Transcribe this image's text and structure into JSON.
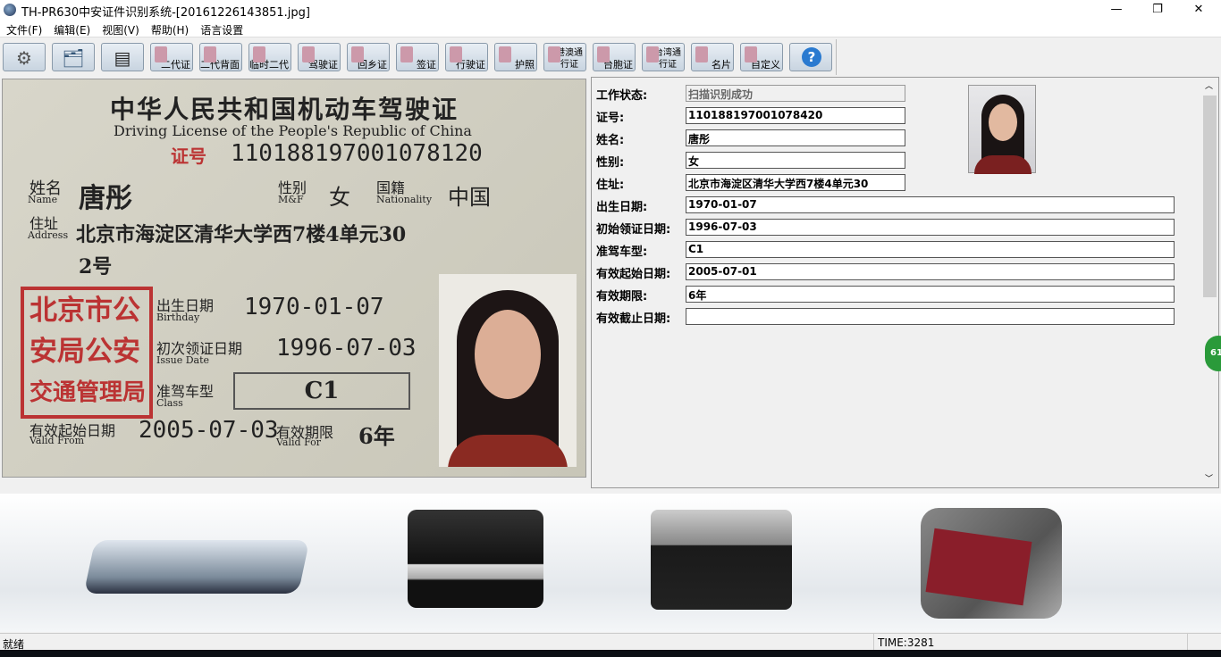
{
  "window": {
    "title": "TH-PR630中安证件识别系统-[20161226143851.jpg]",
    "minimize": "—",
    "restore": "❐",
    "close": "✕"
  },
  "menu": [
    "文件(F)",
    "编辑(E)",
    "视图(V)",
    "帮助(H)",
    "语言设置"
  ],
  "toolbar": [
    {
      "name": "settings",
      "label": "",
      "icon": "gear-icon"
    },
    {
      "name": "batch",
      "label": "",
      "icon": "cards-icon"
    },
    {
      "name": "scan",
      "label": "",
      "icon": "scanner-icon"
    },
    {
      "name": "id-card-2nd",
      "label": "二代证"
    },
    {
      "name": "id-card-back",
      "label": "二代背面"
    },
    {
      "name": "temp-id",
      "label": "临时二代"
    },
    {
      "name": "driving-license",
      "label": "驾驶证"
    },
    {
      "name": "home-return",
      "label": "回乡证"
    },
    {
      "name": "visa",
      "label": "签证"
    },
    {
      "name": "vehicle-license",
      "label": "行驶证"
    },
    {
      "name": "passport",
      "label": "护照"
    },
    {
      "name": "hk-macau-permit",
      "label": "港澳通行证"
    },
    {
      "name": "taiwan-compat",
      "label": "台胞证"
    },
    {
      "name": "taiwan-permit",
      "label": "台湾通行证"
    },
    {
      "name": "business-card",
      "label": "名片"
    },
    {
      "name": "custom",
      "label": "自定义"
    },
    {
      "name": "help",
      "label": "?",
      "icon": "help-icon"
    }
  ],
  "card": {
    "title_cn": "中华人民共和国机动车驾驶证",
    "title_en": "Driving License of the People's Republic of China",
    "no_label": "证号",
    "no": "110188197001078120",
    "name_label": "姓名",
    "name_en": "Name",
    "name": "唐彤",
    "sex_label": "性别",
    "sex_en": "M&F",
    "sex": "女",
    "nat_label": "国籍",
    "nat_en": "Nationality",
    "nat": "中国",
    "addr_label": "住址",
    "addr_en": "Address",
    "addr1": "北京市海淀区清华大学西7楼4单元30",
    "addr2": "2号",
    "seal": [
      "北京市公",
      "安局公安",
      "交通管理局"
    ],
    "birth_label": "出生日期",
    "birth_en": "Birthday",
    "birth": "1970-01-07",
    "issue_label": "初次领证日期",
    "issue_en": "Issue Date",
    "issue": "1996-07-03",
    "class_label": "准驾车型",
    "class_en": "Class",
    "class": "C1",
    "valid_label": "有效起始日期",
    "valid_en": "Valid From",
    "valid": "2005-07-03",
    "period_label": "有效期限",
    "period_en": "Valid For",
    "period": "6年"
  },
  "fields": [
    {
      "label": "工作状态:",
      "value": "扫描识别成功",
      "readonly": true
    },
    {
      "label": "证号:",
      "value": "110188197001078420"
    },
    {
      "label": "姓名:",
      "value": "唐彤"
    },
    {
      "label": "性别:",
      "value": "女"
    },
    {
      "label": "住址:",
      "value": "北京市海淀区清华大学西7楼4单元30"
    },
    {
      "label": "出生日期:",
      "value": "1970-01-07"
    },
    {
      "label": "初始领证日期:",
      "value": "1996-07-03"
    },
    {
      "label": "准驾车型:",
      "value": "C1"
    },
    {
      "label": "有效起始日期:",
      "value": "2005-07-01"
    },
    {
      "label": "有效期限:",
      "value": "6年"
    },
    {
      "label": "有效截止日期:",
      "value": ""
    }
  ],
  "badge": "61",
  "status": {
    "left": "就绪",
    "time": "TIME:3281"
  }
}
